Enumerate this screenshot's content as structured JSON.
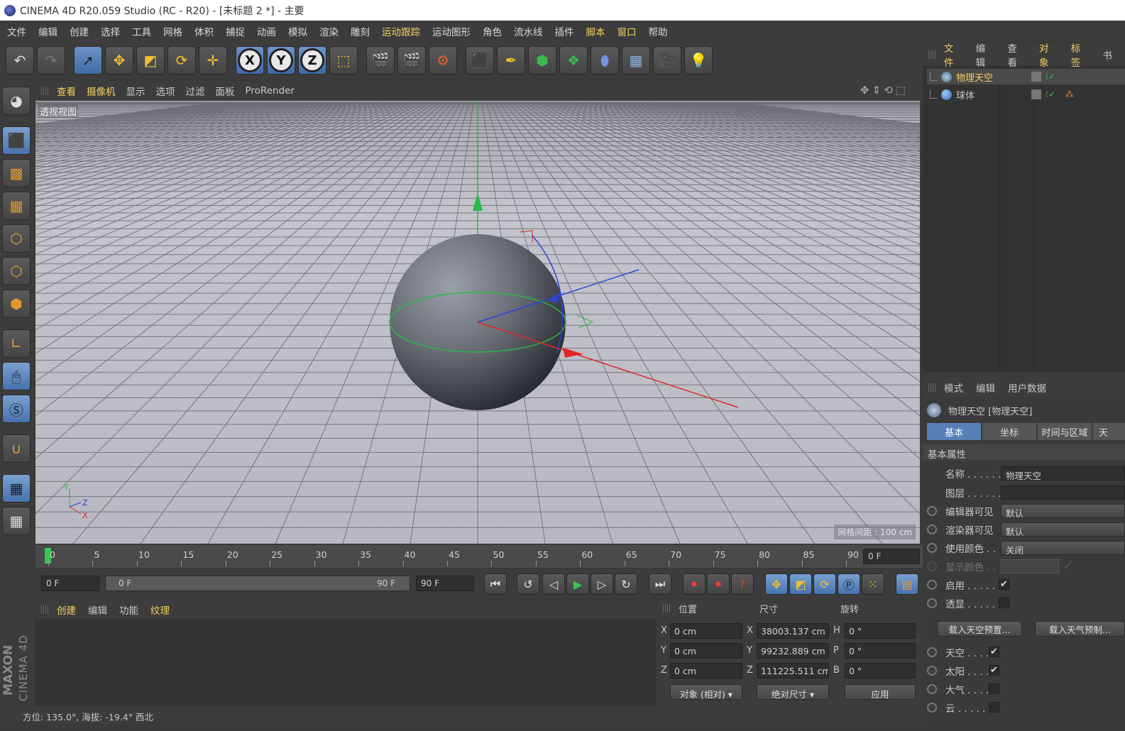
{
  "window": {
    "title": "CINEMA 4D R20.059 Studio (RC - R20) - [未标题 2 *] - 主要"
  },
  "menu": {
    "items": [
      "文件",
      "编辑",
      "创建",
      "选择",
      "工具",
      "网格",
      "体积",
      "捕捉",
      "动画",
      "模拟",
      "渲染",
      "雕刻",
      "运动跟踪",
      "运动图形",
      "角色",
      "流水线",
      "插件",
      "脚本",
      "窗口",
      "帮助"
    ]
  },
  "viewport": {
    "menu": [
      "查看",
      "摄像机",
      "显示",
      "选项",
      "过滤",
      "面板",
      "ProRender"
    ],
    "label": "透视视图",
    "grid_info": "网格间距 : 100 cm",
    "axis_y": "Y",
    "axis_z": "Z",
    "axis_x": "X"
  },
  "timeline": {
    "ticks": [
      "0",
      "5",
      "10",
      "15",
      "20",
      "25",
      "30",
      "35",
      "40",
      "45",
      "50",
      "55",
      "60",
      "65",
      "70",
      "75",
      "80",
      "85",
      "90"
    ],
    "current_frame": "0 F",
    "start_frame": "0 F",
    "range_start": "0 F",
    "range_end": "90 F",
    "end_frame": "90 F"
  },
  "materials": {
    "menu": [
      "创建",
      "编辑",
      "功能",
      "纹理"
    ]
  },
  "coordinates": {
    "headers": {
      "position": "位置",
      "size": "尺寸",
      "rotation": "旋转"
    },
    "rows": [
      {
        "axis": "X",
        "pos": "0 cm",
        "size_axis": "X",
        "size": "38003.137 cm",
        "rot_axis": "H",
        "rot": "0 °"
      },
      {
        "axis": "Y",
        "pos": "0 cm",
        "size_axis": "Y",
        "size": "99232.889 cm",
        "rot_axis": "P",
        "rot": "0 °"
      },
      {
        "axis": "Z",
        "pos": "0 cm",
        "size_axis": "Z",
        "size": "111225.511 cm",
        "rot_axis": "B",
        "rot": "0 °"
      }
    ],
    "mode": "对象 (相对)",
    "size_mode": "绝对尺寸",
    "apply": "应用"
  },
  "status": {
    "text": "方位: 135.0°, 海拔: -19.4° 西北"
  },
  "brand": {
    "maxon": "MAXON",
    "cinema": "CINEMA 4D"
  },
  "objects": {
    "menu": [
      "文件",
      "编辑",
      "查看",
      "对象",
      "标签",
      "书"
    ],
    "items": [
      {
        "name": "物理天空",
        "selected": true
      },
      {
        "name": "球体",
        "selected": false
      }
    ]
  },
  "attributes": {
    "menu": [
      "模式",
      "编辑",
      "用户数据"
    ],
    "title": "物理天空 [物理天空]",
    "tabs": [
      "基本",
      "坐标",
      "时间与区域",
      "天"
    ],
    "section": "基本属性",
    "fields": {
      "name_label": "名称 . . . . . .",
      "name_value": "物理天空",
      "layer_label": "图层 . . . . . .",
      "editor_visible_label": "编辑器可见",
      "editor_visible_value": "默认",
      "render_visible_label": "渲染器可见",
      "render_visible_value": "默认",
      "use_color_label": "使用颜色 . .",
      "use_color_value": "关闭",
      "display_color_label": "显示颜色 . .",
      "enable_label": "启用 . . . . . .",
      "xray_label": "透显 . . . . . ."
    },
    "buttons": [
      "载入天空预置...",
      "载入天气预制..."
    ],
    "components": [
      {
        "label": "天空 . . . .",
        "checked": true
      },
      {
        "label": "太阳 . . . .",
        "checked": true
      },
      {
        "label": "大气 . . . .",
        "checked": false
      },
      {
        "label": "云 . . . . . .",
        "checked": false
      }
    ],
    "check_mark": "✔"
  }
}
